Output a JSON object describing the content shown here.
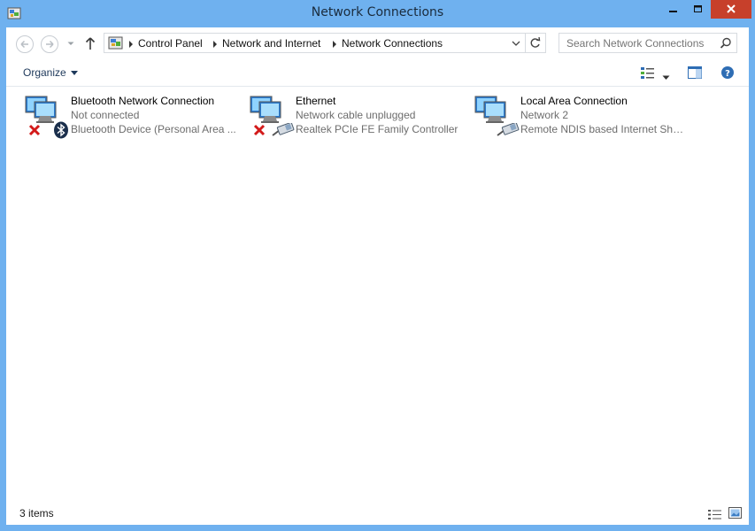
{
  "window": {
    "title": "Network Connections",
    "app_icon": "control-panel-network-icon",
    "accent_color": "#6fb1ef",
    "close_color": "#c7402b"
  },
  "address": {
    "root_icon": "control-panel-icon",
    "crumbs": [
      "Control Panel",
      "Network and Internet",
      "Network Connections"
    ],
    "search_placeholder": "Search Network Connections"
  },
  "toolbar": {
    "organize_label": "Organize"
  },
  "items": [
    {
      "name": "Bluetooth Network Connection",
      "status": "Not connected",
      "device": "Bluetooth Device (Personal Area ...",
      "icon": "network-computers-icon",
      "badge": "disconnected-x-icon",
      "adapter": "bluetooth-icon"
    },
    {
      "name": "Ethernet",
      "status": "Network cable unplugged",
      "device": "Realtek PCIe FE Family Controller",
      "icon": "network-computers-icon",
      "badge": "disconnected-x-icon",
      "adapter": "network-cable-icon"
    },
    {
      "name": "Local Area Connection",
      "status": "Network  2",
      "device": "Remote NDIS based Internet Shari...",
      "icon": "network-computers-icon",
      "badge": "",
      "adapter": "network-cable-icon"
    }
  ],
  "statusbar": {
    "item_count": "3 items"
  }
}
